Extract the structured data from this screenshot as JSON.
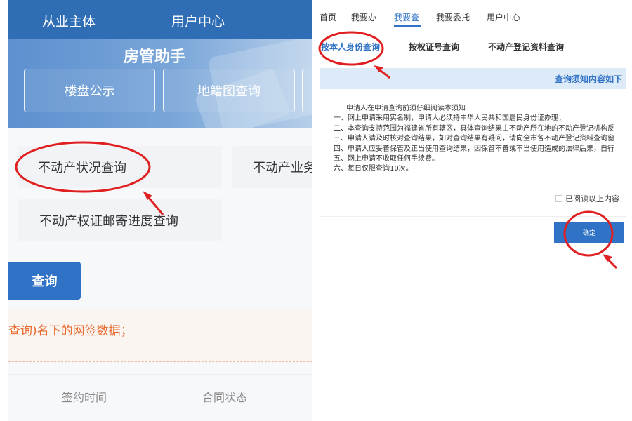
{
  "left": {
    "topnav": {
      "subject": "从业主体",
      "user_center": "用户中心"
    },
    "banner": {
      "title": "房管助手",
      "tiles": [
        "楼盘公示",
        "地籍图查询",
        ""
      ]
    },
    "services": {
      "status_query": "不动产状况查询",
      "business": "不动产业务",
      "mail_progress": "不动产权证邮寄进度查询"
    },
    "query_button": "查询",
    "notice": "查询)名下的网签数据；",
    "table_headers": {
      "sign_time": "签约时间",
      "contract_status": "合同状态"
    }
  },
  "right": {
    "nav": {
      "home": "首页",
      "todo": "我要办",
      "query": "我要查",
      "entrust": "我要委托",
      "user_center": "用户中心"
    },
    "tabs": {
      "by_identity": "按本人身份查询",
      "by_cert_no": "按权证号查询",
      "by_documents": "不动产登记资料查询"
    },
    "notice_header": "查询须知内容如下",
    "rules": {
      "intro": "申请人在申请查询前须仔细阅读本须知",
      "items": [
        "一、网上申请采用实名制，申请人必须持中华人民共和国居民身份证办理；",
        "二、本查询支持范围为福建省所有辖区，具体查询结果由不动产所在地的不动产登记机构反",
        "三、申请人请及时核对查询结果，如对查询结果有疑问，请向全市各不动产登记资料查询窗",
        "四、申请人应妥善保管及正当使用查询结果，因保管不善或不当使用造成的法律后果，自行",
        "五、网上申请不收取任何手续费。",
        "六、每日仅限查询10次。"
      ]
    },
    "agree_label": "已阅读以上内容",
    "confirm_button": "确定"
  },
  "colors": {
    "brand_blue": "#2f72c6",
    "annotation_red": "#e02020",
    "notice_orange": "#e86a2e"
  }
}
